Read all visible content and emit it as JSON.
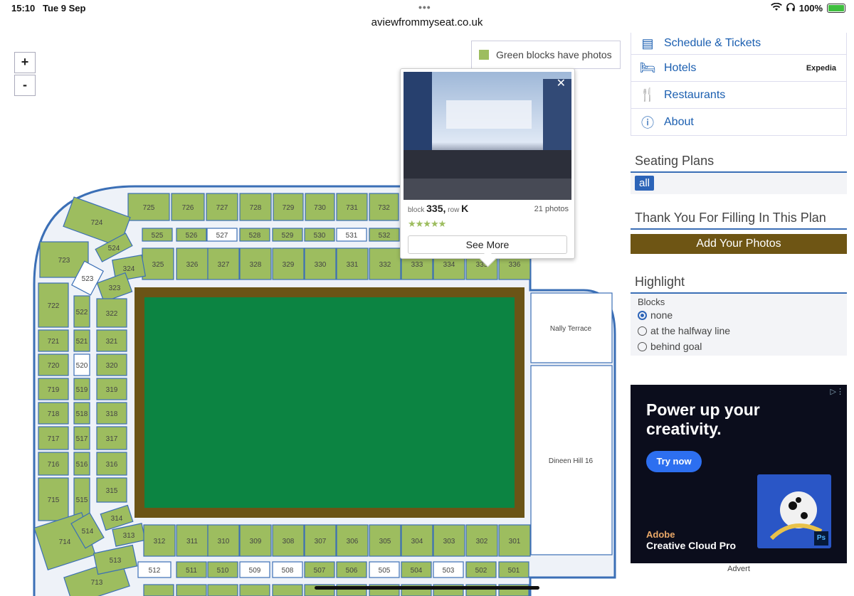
{
  "status": {
    "time": "15:10",
    "date": "Tue 9 Sep",
    "battery": "100%"
  },
  "browser": {
    "url": "aviewfrommyseat.co.uk"
  },
  "map": {
    "zoom_in": "+",
    "zoom_out": "-",
    "legend": "Green blocks have photos",
    "colors": {
      "has_photos": "#9dbd5f",
      "no_photos": "#ffffff",
      "pitch": "#0c8442",
      "pitch_border": "#6b5416",
      "stand_outline": "#3b6fb6"
    },
    "top_row_7": [
      "725",
      "726",
      "727",
      "728",
      "729",
      "730",
      "731",
      "732"
    ],
    "top_row_5": [
      "525",
      "526",
      "527",
      "528",
      "529",
      "530",
      "531",
      "532"
    ],
    "top_row_5_no_photo": [
      "527",
      "531"
    ],
    "top_row_3": [
      "325",
      "326",
      "327",
      "328",
      "329",
      "330",
      "331",
      "332",
      "333",
      "334",
      "335",
      "336"
    ],
    "corner_top": [
      "724",
      "723",
      "524",
      "523",
      "324",
      "323"
    ],
    "left_7": [
      "722",
      "721",
      "720",
      "719",
      "718",
      "717",
      "716",
      "715"
    ],
    "left_5": [
      "522",
      "521",
      "520",
      "519",
      "518",
      "517",
      "516",
      "515"
    ],
    "left_5_no_photo": [
      "520"
    ],
    "left_3": [
      "322",
      "321",
      "320",
      "319",
      "318",
      "317",
      "316",
      "315"
    ],
    "corner_bottom": [
      "714",
      "713",
      "514",
      "513",
      "314",
      "313"
    ],
    "bottom_row_3": [
      "312",
      "311",
      "310",
      "309",
      "308",
      "307",
      "306",
      "305",
      "304",
      "303",
      "302",
      "301"
    ],
    "bottom_row_5": [
      "512",
      "511",
      "510",
      "509",
      "508",
      "507",
      "506",
      "505",
      "504",
      "503",
      "502",
      "501"
    ],
    "bottom_row_5_no_photo": [
      "512",
      "509",
      "508",
      "505",
      "503"
    ],
    "terraces": [
      "Nally Terrace",
      "Dineen Hill 16"
    ]
  },
  "popup": {
    "block_label": "block",
    "block": "335,",
    "row_label": "row",
    "row": "K",
    "photos": "21 photos",
    "stars": "★★★★★",
    "see_more": "See More"
  },
  "sidebar": {
    "nav": [
      {
        "label": "Schedule & Tickets",
        "icon": "calendar-icon"
      },
      {
        "label": "Hotels",
        "icon": "bed-icon",
        "partner": "Expedia"
      },
      {
        "label": "Restaurants",
        "icon": "restaurant-icon"
      },
      {
        "label": "About",
        "icon": "info-icon"
      }
    ],
    "seating_title": "Seating Plans",
    "all_label": "all",
    "thanks_title": "Thank You For Filling In This Plan",
    "add_photos": "Add Your Photos",
    "highlight_title": "Highlight",
    "blocks_label": "Blocks",
    "options": [
      "none",
      "at the halfway line",
      "behind goal"
    ],
    "selected_option": "none"
  },
  "ad": {
    "headline_1": "Power up your",
    "headline_2": "creativity.",
    "cta": "Try now",
    "brand": "Adobe",
    "product": "Creative Cloud Pro",
    "badge": "Ps",
    "label": "Advert"
  }
}
